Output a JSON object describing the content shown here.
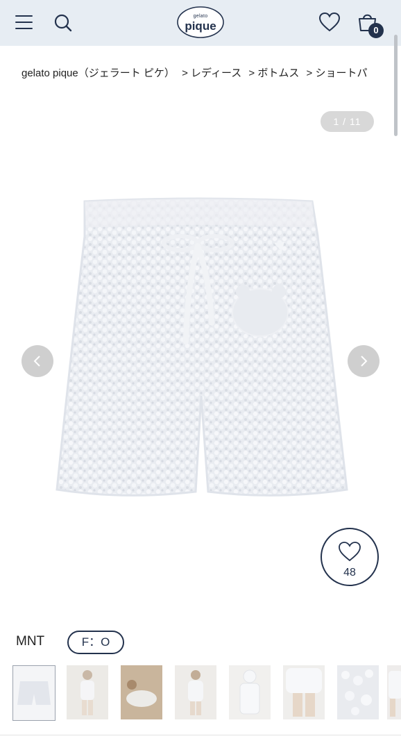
{
  "header": {
    "menu_icon": "hamburger-menu-icon",
    "search_icon": "search-icon",
    "logo_small": "gelato",
    "logo_main": "pique",
    "favorites_icon": "heart-icon",
    "cart_icon": "shopping-bag-icon",
    "cart_count": "0",
    "accent_color": "#23324d",
    "background_color": "#e7edf3"
  },
  "breadcrumb": {
    "items": [
      "gelato pique（ジェラート ピケ）",
      "> レディース",
      "> ボトムス",
      "> ショートパ"
    ]
  },
  "gallery": {
    "counter": "1 / 11",
    "prev_icon": "chevron-left-icon",
    "next_icon": "chevron-right-icon",
    "image": "fluffy-knit-shorts"
  },
  "favorite": {
    "icon": "heart-icon",
    "count": "48"
  },
  "variant": {
    "color": "MNT",
    "size": "F：O"
  },
  "thumbnails": [
    {
      "label": "shorts-flat",
      "selected": true
    },
    {
      "label": "model-full-white"
    },
    {
      "label": "model-sitting"
    },
    {
      "label": "model-full-hood"
    },
    {
      "label": "model-hoodie-front"
    },
    {
      "label": "model-legs-close"
    },
    {
      "label": "texture-close-up"
    },
    {
      "label": "model-partial"
    }
  ]
}
